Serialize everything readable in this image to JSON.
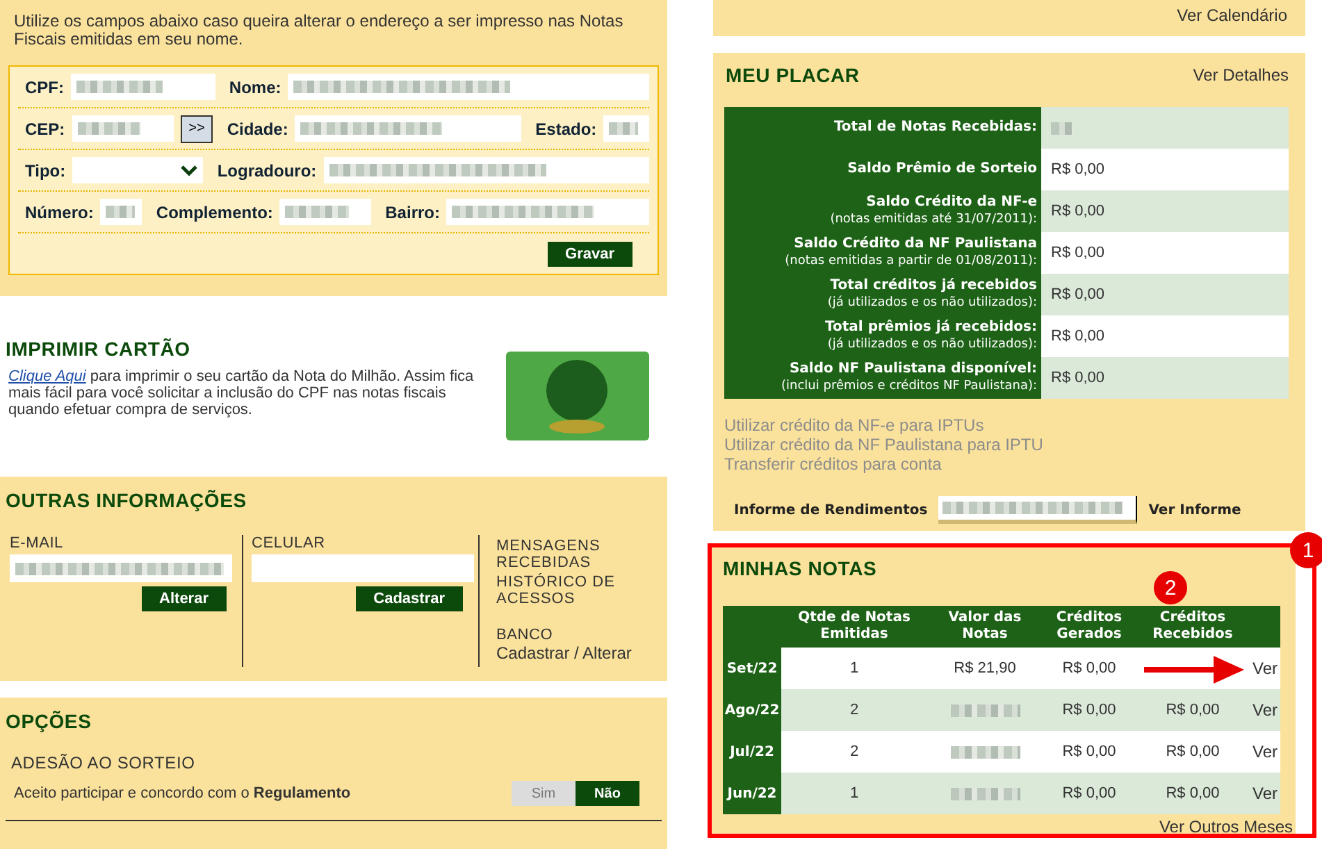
{
  "address_form": {
    "intro": "Utilize os campos abaixo caso queira alterar o endereço a ser impresso nas Notas Fiscais emitidas em seu nome.",
    "rows": [
      [
        {
          "label": "CPF:",
          "kind": "text",
          "blurred": true
        },
        {
          "label": "Nome:",
          "kind": "text",
          "blurred": true
        }
      ],
      [
        {
          "label": "CEP:",
          "kind": "lookup",
          "blurred": true,
          "button": ">>"
        },
        {
          "label": "Cidade:",
          "kind": "text",
          "blurred": true
        },
        {
          "label": "Estado:",
          "kind": "text",
          "blurred": true
        }
      ],
      [
        {
          "label": "Tipo:",
          "kind": "select",
          "blurred": false
        },
        {
          "label": "Logradouro:",
          "kind": "text",
          "blurred": true
        }
      ],
      [
        {
          "label": "Número:",
          "kind": "text",
          "blurred": true
        },
        {
          "label": "Complemento:",
          "kind": "text",
          "blurred": true
        },
        {
          "label": "Bairro:",
          "kind": "text",
          "blurred": true
        }
      ]
    ],
    "button": "Gravar"
  },
  "print_card": {
    "title": "IMPRIMIR CARTÃO",
    "link": "Clique Aqui",
    "text": " para imprimir o seu cartão da Nota do Milhão. Assim fica mais fácil para você solicitar a inclusão do CPF nas notas fiscais quando efetuar compra de serviços."
  },
  "other_info": {
    "title": "OUTRAS INFORMAÇÕES",
    "email": {
      "label": "E-MAIL",
      "blurred": true,
      "button": "Alterar"
    },
    "phone": {
      "label": "CELULAR",
      "blurred": false,
      "button": "Cadastrar"
    },
    "links": [
      "MENSAGENS RECEBIDAS",
      "HISTÓRICO DE ACESSOS"
    ],
    "bank": {
      "title": "BANCO",
      "link": "Cadastrar / Alterar"
    }
  },
  "options": {
    "title": "OPÇÕES",
    "section": "ADESÃO AO SORTEIO",
    "text": "Aceito participar e concordo com o **Regulamento**",
    "toggle": [
      {
        "label": "Sim",
        "selected": false
      },
      {
        "label": "Não",
        "selected": true
      }
    ]
  },
  "top_links": [
    "Ver Calendário"
  ],
  "scoreboard": {
    "title": "MEU PLACAR",
    "details_link": "Ver Detalhes",
    "rows": [
      {
        "label": "Total de Notas Recebidas:",
        "blurred": true
      },
      {
        "label": "Saldo Prêmio de Sorteio",
        "value": "R$ 0,00"
      },
      {
        "label": "Saldo Crédito da NF-e",
        "note": "(notas emitidas até 31/07/2011):",
        "value": "R$ 0,00"
      },
      {
        "label": "Saldo Crédito da NF Paulistana",
        "note": "(notas emitidas a partir de 01/08/2011):",
        "value": "R$ 0,00"
      },
      {
        "label": "Total créditos já recebidos",
        "note": "(já utilizados e os não utilizados):",
        "value": "R$ 0,00"
      },
      {
        "label": "Total prêmios já recebidos:",
        "note": "(já utilizados e os não utilizados):",
        "value": "R$ 0,00"
      },
      {
        "label": "Saldo NF Paulistana disponível:",
        "note": "(inclui prêmios e créditos NF Paulistana):",
        "value": "R$ 0,00"
      }
    ],
    "links": [
      "Utilizar crédito da NF-e para IPTUs",
      "Utilizar crédito da NF Paulistana para IPTU",
      "Transferir créditos para conta"
    ],
    "income_report": {
      "label": "Informe de Rendimentos",
      "blurred": true,
      "link": "Ver Informe"
    }
  },
  "my_invoices": {
    "title": "MINHAS NOTAS",
    "columns": [
      "Qtde de Notas Emitidas",
      "Valor das Notas",
      "Créditos Gerados",
      "Créditos Recebidos"
    ],
    "rows": [
      {
        "month": "Set/22",
        "count": "1",
        "amount": "R$ 21,90",
        "generated": "R$ 0,00",
        "link": "Ver"
      },
      {
        "month": "Ago/22",
        "count": "2",
        "amount_blurred": true,
        "generated": "R$ 0,00",
        "received": "R$ 0,00",
        "link": "Ver"
      },
      {
        "month": "Jul/22",
        "count": "2",
        "amount_blurred": true,
        "generated": "R$ 0,00",
        "received": "R$ 0,00",
        "link": "Ver"
      },
      {
        "month": "Jun/22",
        "count": "1",
        "amount_blurred": true,
        "generated": "R$ 0,00",
        "received": "R$ 0,00",
        "link": "Ver"
      }
    ],
    "more_link": "Ver Outros Meses"
  },
  "callouts": [
    {
      "number": "1"
    },
    {
      "number": "2",
      "arrow": true
    }
  ]
}
